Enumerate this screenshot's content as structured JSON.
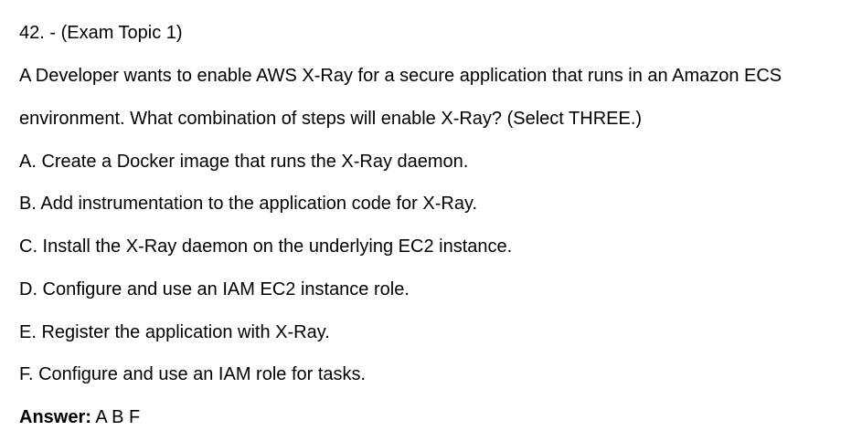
{
  "question": {
    "header": "42. - (Exam Topic 1)",
    "text_line1": "A Developer wants to enable AWS X-Ray for a secure application that runs in an Amazon ECS",
    "text_line2": "environment. What combination of steps will enable X-Ray? (Select THREE.)"
  },
  "options": [
    "A. Create a Docker image that runs the X-Ray daemon.",
    "B. Add instrumentation to the application code for X-Ray.",
    "C. Install the X-Ray daemon on the underlying EC2 instance.",
    "D. Configure and use an IAM EC2 instance role.",
    "E. Register the application with X-Ray.",
    "F. Configure and use an IAM role for tasks."
  ],
  "answer": {
    "label": "Answer:",
    "value": "A B F"
  }
}
